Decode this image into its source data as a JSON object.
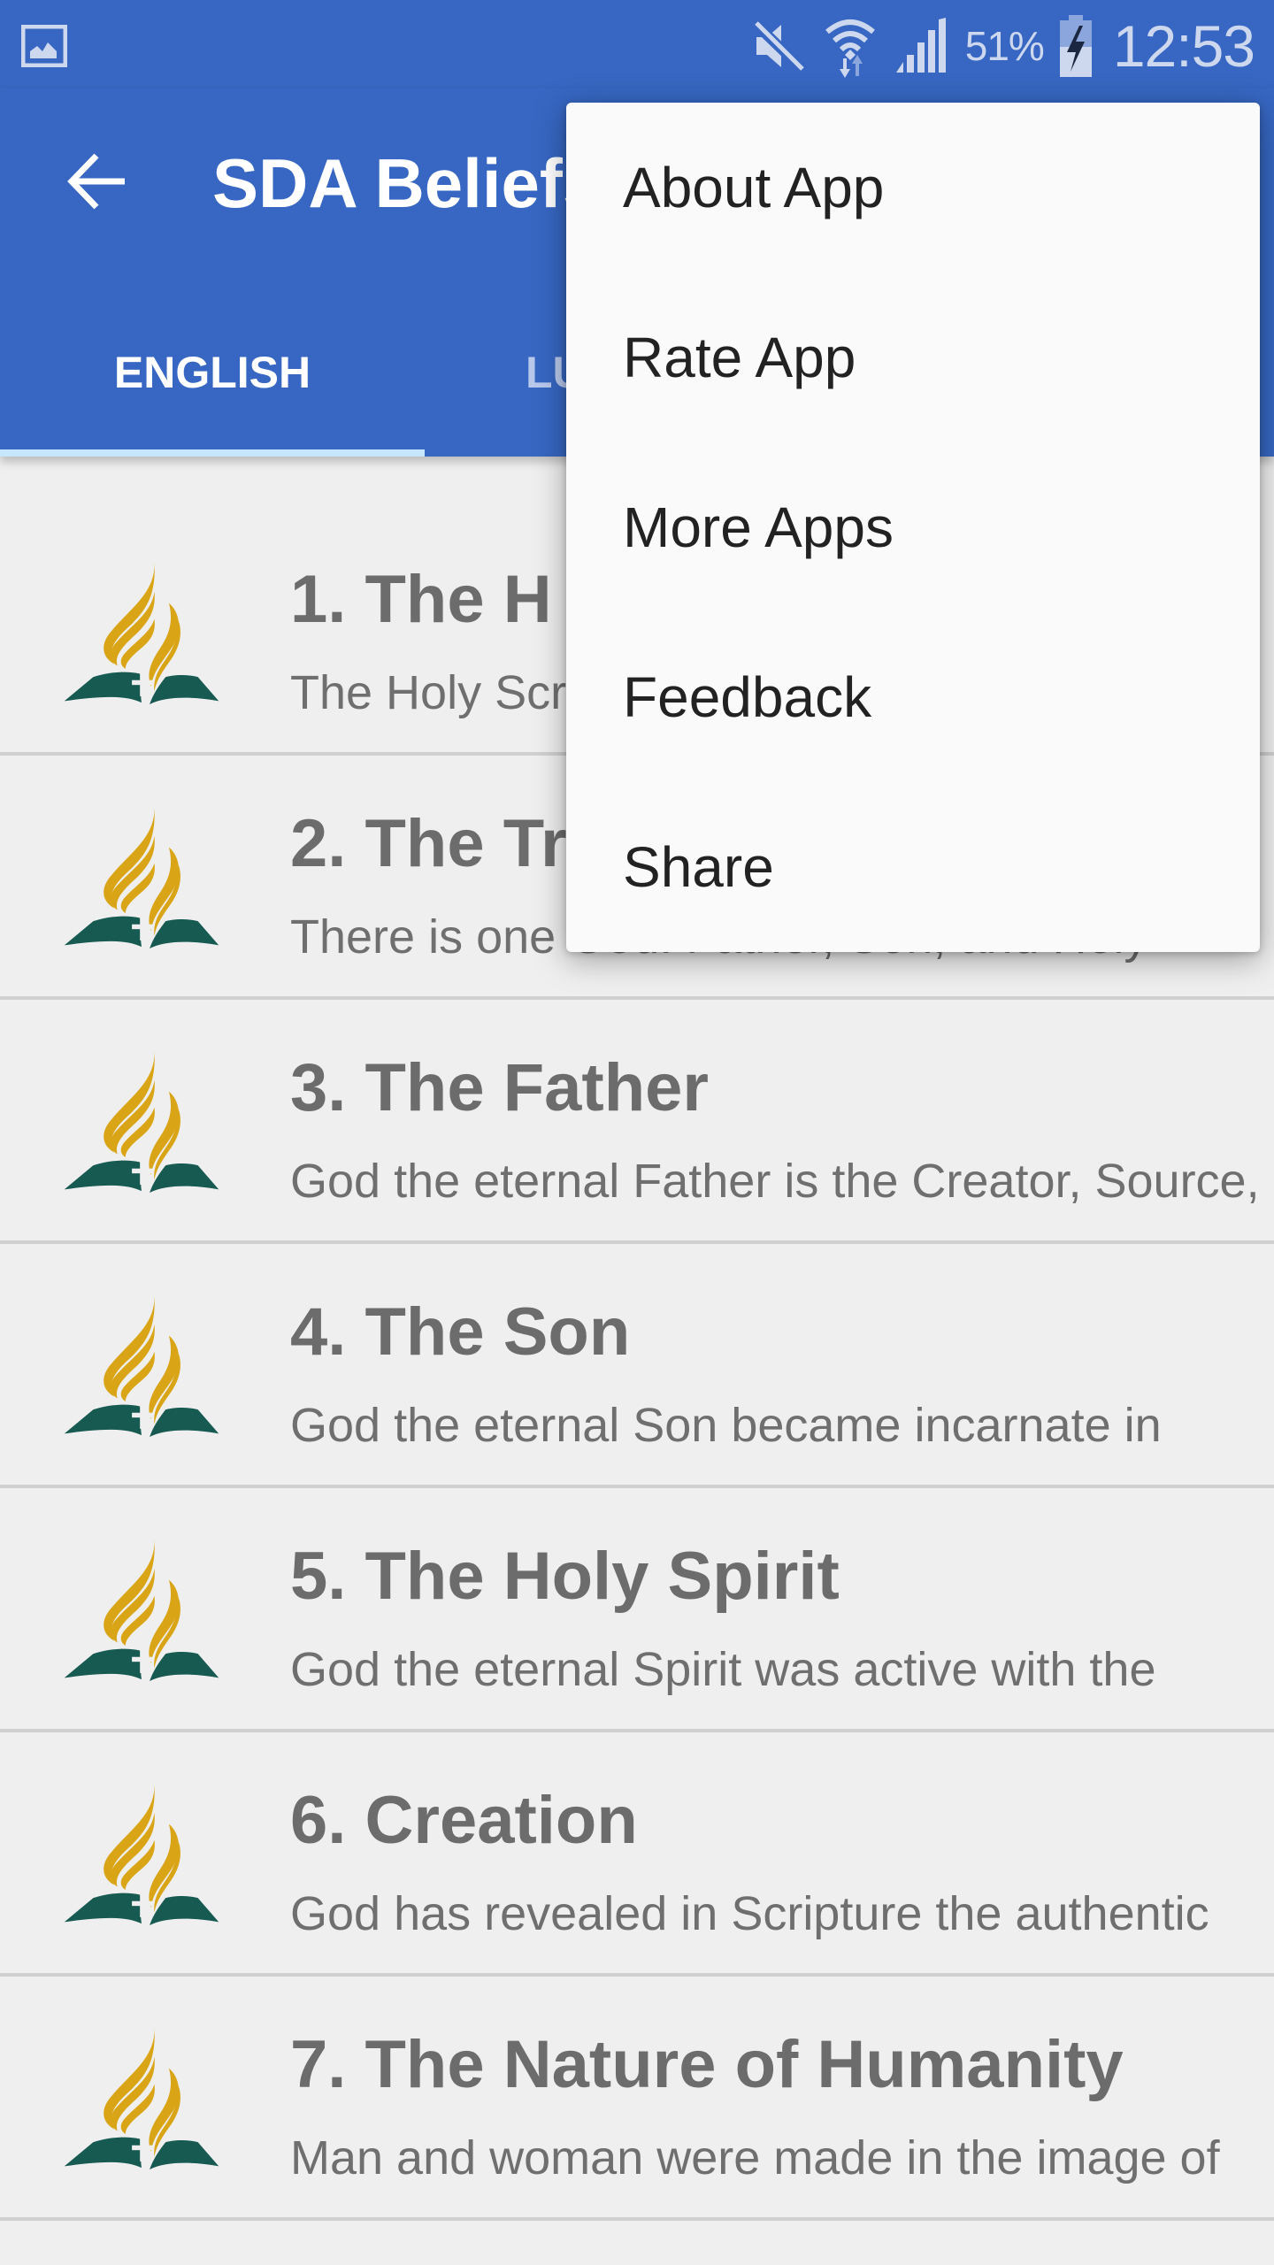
{
  "status_bar": {
    "left_icon": "gallery-notification-icon",
    "icons": [
      "mute-icon",
      "wifi-icon",
      "signal-icon",
      "battery-charging-icon"
    ],
    "battery_percent": "51%",
    "time": "12:53"
  },
  "app_bar": {
    "back_icon": "arrow-left-icon",
    "title": "SDA Beliefs",
    "tabs": [
      {
        "label": "ENGLISH",
        "active": true
      },
      {
        "label": "LU",
        "active": false
      }
    ],
    "colors": {
      "primary": "#3767c2",
      "tab_indicator": "#c5e6fb"
    }
  },
  "list": {
    "items": [
      {
        "title": "1. The H",
        "subtitle": "The Holy Scr",
        "icon": "sda-logo-icon"
      },
      {
        "title": "2. The Tr",
        "subtitle": "There is one God: Father, Son, and Holy",
        "icon": "sda-logo-icon"
      },
      {
        "title": "3. The Father",
        "subtitle": "God the eternal Father is the Creator, Source,",
        "icon": "sda-logo-icon"
      },
      {
        "title": "4. The Son",
        "subtitle": "God the eternal Son became incarnate in",
        "icon": "sda-logo-icon"
      },
      {
        "title": "5. The Holy Spirit",
        "subtitle": "God the eternal Spirit was active with the",
        "icon": "sda-logo-icon"
      },
      {
        "title": "6. Creation",
        "subtitle": "God has revealed in Scripture the authentic",
        "icon": "sda-logo-icon"
      },
      {
        "title": "7. The Nature of Humanity",
        "subtitle": "Man and woman were made in the image of",
        "icon": "sda-logo-icon"
      }
    ],
    "colors": {
      "logo_gold": "#d9a517",
      "logo_green": "#175a52"
    }
  },
  "overflow_menu": {
    "items": [
      {
        "label": "About App"
      },
      {
        "label": "Rate App"
      },
      {
        "label": "More Apps"
      },
      {
        "label": "Feedback"
      },
      {
        "label": "Share"
      }
    ]
  }
}
